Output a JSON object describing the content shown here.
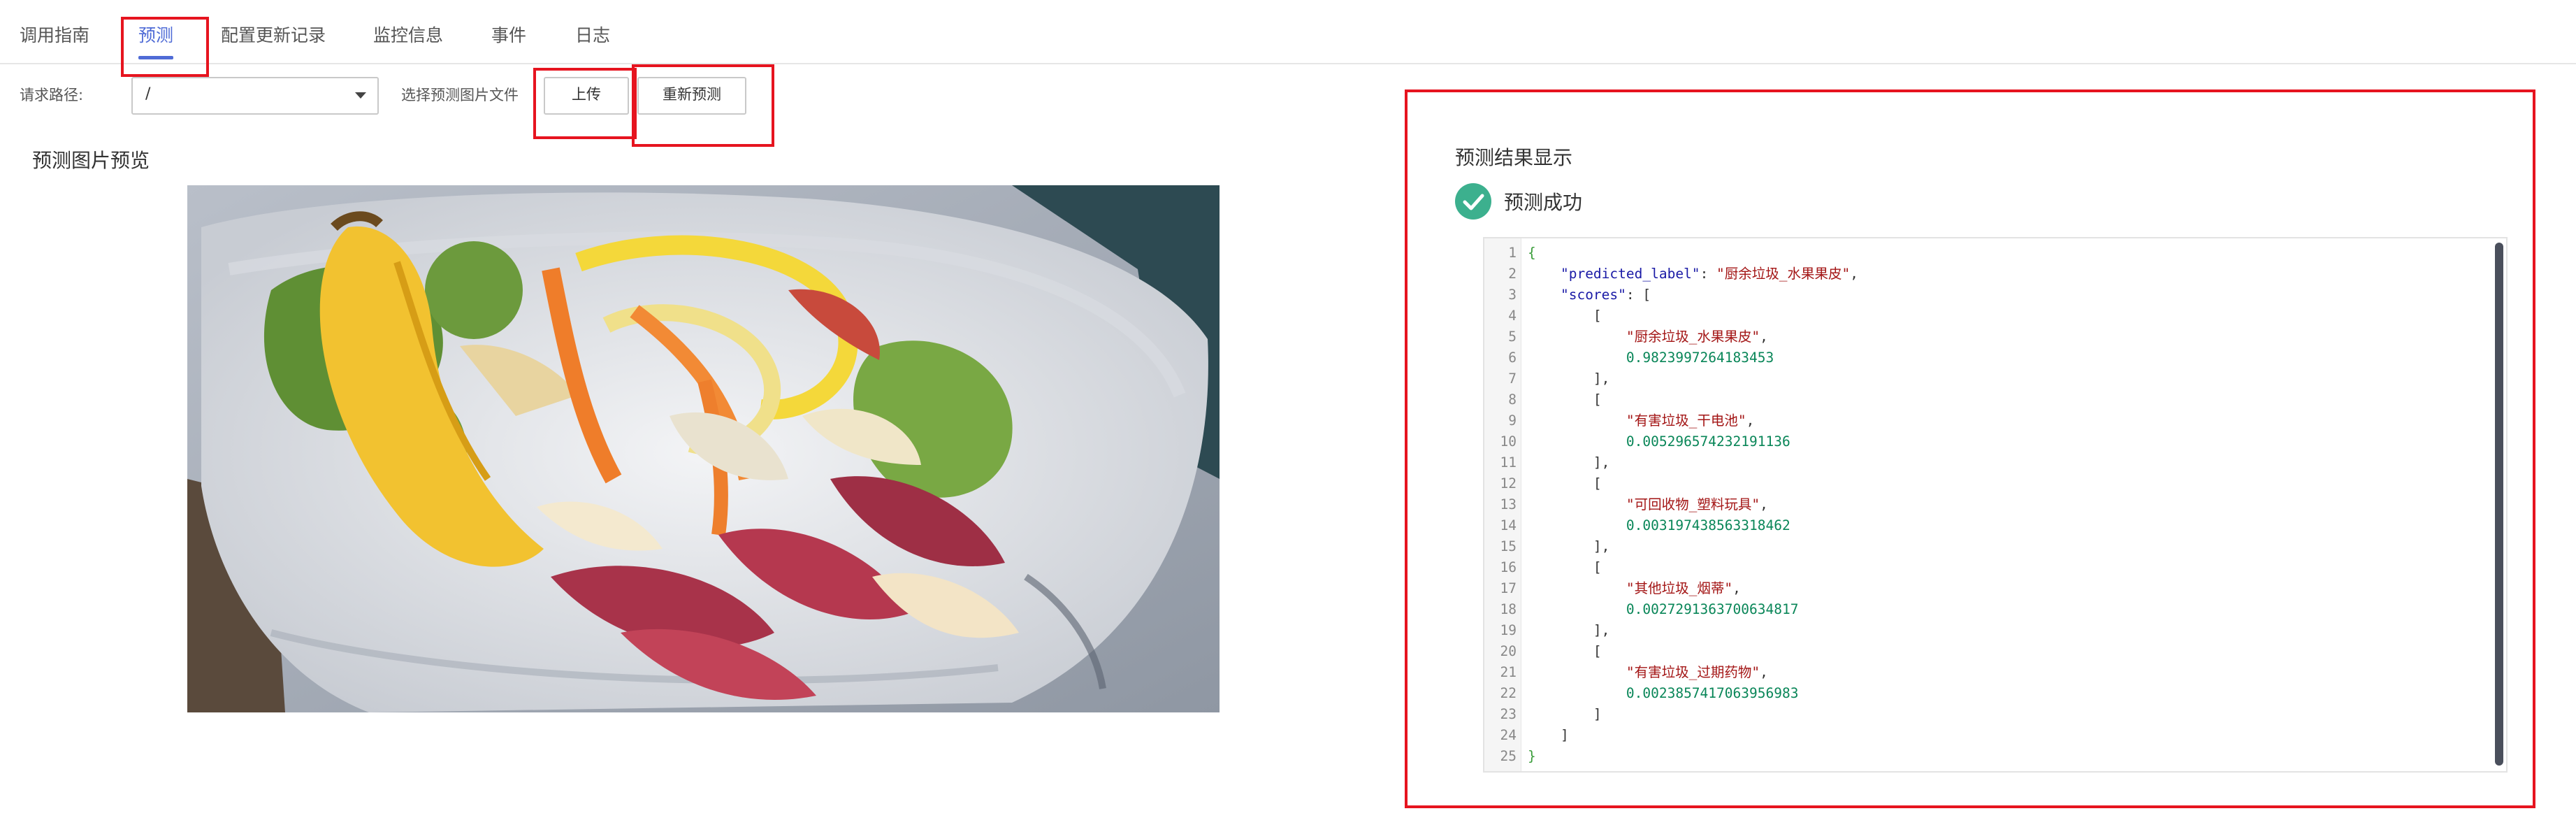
{
  "tabs": [
    {
      "label": "调用指南"
    },
    {
      "label": "预测"
    },
    {
      "label": "配置更新记录"
    },
    {
      "label": "监控信息"
    },
    {
      "label": "事件"
    },
    {
      "label": "日志"
    }
  ],
  "toolbar": {
    "path_label": "请求路径:",
    "path_value": "/",
    "file_label": "选择预测图片文件",
    "upload_label": "上传",
    "repredict_label": "重新预测"
  },
  "preview": {
    "title": "预测图片预览"
  },
  "result": {
    "title": "预测结果显示",
    "status": "预测成功",
    "line_numbers": [
      "1",
      "2",
      "3",
      "4",
      "5",
      "6",
      "7",
      "8",
      "9",
      "10",
      "11",
      "12",
      "13",
      "14",
      "15",
      "16",
      "17",
      "18",
      "19",
      "20",
      "21",
      "22",
      "23",
      "24",
      "25"
    ],
    "json_key_predicted": "\"predicted_label\"",
    "json_val_predicted": "\"厨余垃圾_水果果皮\"",
    "json_key_scores": "\"scores\"",
    "scores": [
      {
        "label": "\"厨余垃圾_水果果皮\"",
        "value": "0.9823997264183453"
      },
      {
        "label": "\"有害垃圾_干电池\"",
        "value": "0.005296574232191136"
      },
      {
        "label": "\"可回收物_塑料玩具\"",
        "value": "0.003197438563318462"
      },
      {
        "label": "\"其他垃圾_烟蒂\"",
        "value": "0.0027291363700634817"
      },
      {
        "label": "\"有害垃圾_过期药物\"",
        "value": "0.0023857417063956983"
      }
    ]
  },
  "colors": {
    "accent": "#4f6bd6",
    "highlight_box": "#e6141f",
    "success": "#3cb08e"
  }
}
